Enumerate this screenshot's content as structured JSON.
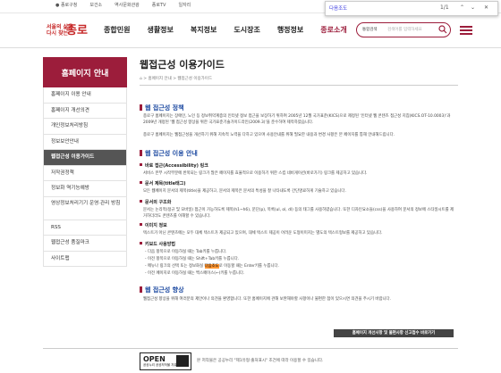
{
  "topbar": {
    "links": [
      "● 종로구청",
      "보건소",
      "역사문화관광",
      "종로TV",
      "일자리",
      "종로TV"
    ]
  },
  "find": {
    "query": "다음조도",
    "count": "1/1"
  },
  "header": {
    "logo_small": "서울의 삶을\n다시 찾는",
    "logo_big": "종로",
    "nav": [
      "종합민원",
      "생활정보",
      "복지정보",
      "도시장조",
      "행정정보",
      "종로소개"
    ],
    "search_select": "통합검색",
    "search_placeholder": "검색어를 입력하세요"
  },
  "sidebar": {
    "title": "홈페이지 안내",
    "items": [
      "홈페이지 이용 안내",
      "홈페이지 개선의견",
      "개인정보처리방침",
      "정보보안안내",
      "웹접근성 이용가이드",
      "저작권정책",
      "정보화 역기능예방",
      "영상정보처리기기 운영·관리 방침",
      "RSS",
      "웹접근성 품질마크",
      "사이트맵"
    ]
  },
  "main": {
    "title": "웹접근성 이용가이드",
    "breadcrumb": "⌂  > 홈페이지 안내  > 웹접근성 이용가이드",
    "sec1_title": "웹 접근성 정책",
    "sec1_text": "종로구 홈페이지는 장애인, 노인 등 정보취약계층의 인터넷 정보 접근을 보장하기 위하여 2005년 12월 국가표준(KICS)으로 제정된 '인터넷 웹 콘텐츠 접근성 지침(KICS.OT-10.0003)'과 2009년 개정된 '웹 접근성 향상을 위한 국가표준기술가이드라인(2009.3)'을 준수하여 제작하였습니다.",
    "sec1_text2": "종로구 홈페이지는 웹접근성을 개선하기 위해 지속적 노력을 다하고 있으며 사용안내를 위해 필요한 내용과 변경 사항은 본 페이지를 통해 안내해드립니다.",
    "sec2_title": "웹 접근성 이용 안내",
    "s1_title": "바로 접근(Accessibility) 링크",
    "s1_text": "서비스 본부 시작부분에 반복되는 링크가 많은 페이지를 효율적으로 이용하기 위한 스킵 네비게이션(바로가기) 링크를 제공하고 있습니다.",
    "s2_title": "문서 제목(title태그)",
    "s2_text": "모든 웹페이지 문서의 제목(title)을 제공하고, 문서의 제목은 문서의 특성을 잘 나타내도록 간단명료하게 기술하고 있습니다.",
    "s3_title": "문서의 구조화",
    "s3_text": "문서는 논리적(정규 및 모바일) 접근이 가능하도록 제목(h1~h6), 문단(p), 목록(ul, ol, dl) 등의 태그를 사용하였습니다. 또한 디자인요소들(css)을 사용하여 문서의 정보에 스타일시트를 제거하더라도 콘텐츠를 이해할 수 있습니다.",
    "s4_title": "이미지 정보",
    "s4_text": "텍스트가 아닌 콘텐츠에는 모두 대체 텍스트가 제공되고 있으며, 대체 텍스트 제공이 어려운 도형이미지는 별도의 텍스트형보를 제공하고 있습니다.",
    "s5_title": "키보드 사용방법",
    "kb": [
      "- 다음 항목으로 이동하실 때는 Tab키를 누릅니다.",
      "- 이전 항목으로 이동하실 때는 Shift+Tab키를 누릅니다.",
      "- 메뉴나 링크의 선택 또는 정보화실 ",
      "- 이전 페이지로 이동하실 때는 백스페이스(←)키를 누릅니다."
    ],
    "kb3_hl": "다음조도",
    "kb3_tail": "로 이동할 때는 Enter키를 누릅니다.",
    "sec3_title": "웹 접근성 향상",
    "sec3_text": "웹접근성 향상을 위해 여러분의 제안이나 의견을 환영합니다. 또한 홈페이지에 관해 보완해야할 사항이나 불편한 점이 있으시면 의견을 주시기 바랍니다.",
    "button": "홈페이지 개선사항 및 불편사항 신고접수 바로가기"
  },
  "footer": {
    "ogl_title": "OPEN",
    "ogl_sub": "공공누리 공공저작물 자유이용허락",
    "text": "본 저작물은 공공누리 \"제1유형:출처표시\" 조건에 따라 이용할 수 있습니다."
  }
}
